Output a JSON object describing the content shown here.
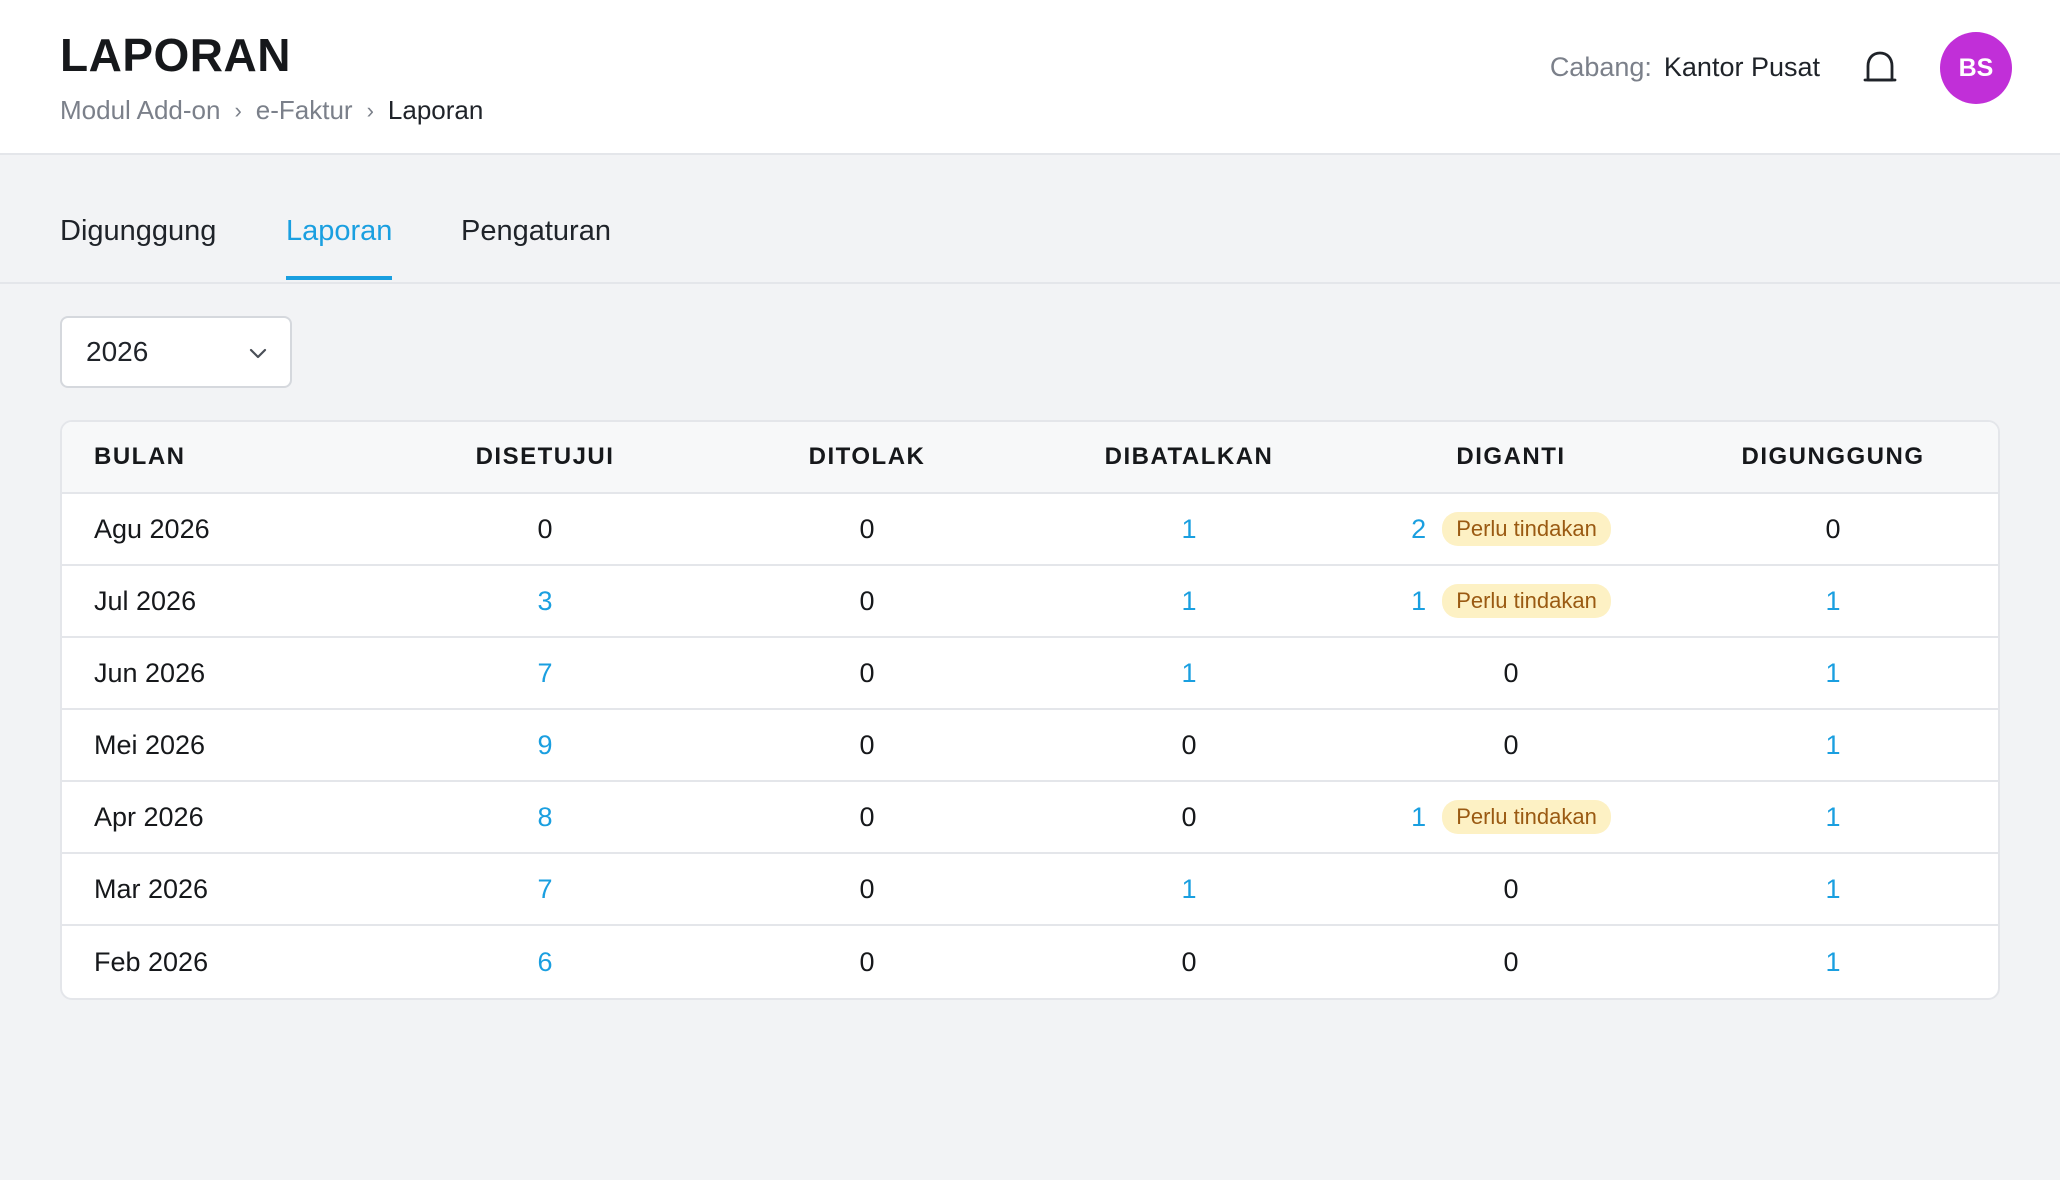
{
  "header": {
    "title": "LAPORAN",
    "breadcrumb": [
      "Modul Add-on",
      "e-Faktur",
      "Laporan"
    ],
    "branch_label": "Cabang:",
    "branch_value": "Kantor Pusat",
    "avatar_initials": "BS",
    "avatar_color": "#c12fd8"
  },
  "tabs": [
    {
      "label": "Digunggung",
      "active": false
    },
    {
      "label": "Laporan",
      "active": true
    },
    {
      "label": "Pengaturan",
      "active": false
    }
  ],
  "filter": {
    "year": "2026"
  },
  "table": {
    "columns": [
      "BULAN",
      "DISETUJUI",
      "DITOLAK",
      "DIBATALKAN",
      "DIGANTI",
      "DIGUNGGUNG"
    ],
    "badge_label": "Perlu tindakan",
    "rows": [
      {
        "bulan": "Agu 2026",
        "disetujui": "0",
        "ditolak": "0",
        "dibatalkan": "1",
        "diganti": "2",
        "diganti_badge": true,
        "digunggung": "0"
      },
      {
        "bulan": "Jul 2026",
        "disetujui": "3",
        "ditolak": "0",
        "dibatalkan": "1",
        "diganti": "1",
        "diganti_badge": true,
        "digunggung": "1"
      },
      {
        "bulan": "Jun 2026",
        "disetujui": "7",
        "ditolak": "0",
        "dibatalkan": "1",
        "diganti": "0",
        "diganti_badge": false,
        "digunggung": "1"
      },
      {
        "bulan": "Mei 2026",
        "disetujui": "9",
        "ditolak": "0",
        "dibatalkan": "0",
        "diganti": "0",
        "diganti_badge": false,
        "digunggung": "1"
      },
      {
        "bulan": "Apr 2026",
        "disetujui": "8",
        "ditolak": "0",
        "dibatalkan": "0",
        "diganti": "1",
        "diganti_badge": true,
        "digunggung": "1"
      },
      {
        "bulan": "Mar 2026",
        "disetujui": "7",
        "ditolak": "0",
        "dibatalkan": "1",
        "diganti": "0",
        "diganti_badge": false,
        "digunggung": "1"
      },
      {
        "bulan": "Feb 2026",
        "disetujui": "6",
        "ditolak": "0",
        "dibatalkan": "0",
        "diganti": "0",
        "diganti_badge": false,
        "digunggung": "1"
      }
    ]
  },
  "colors": {
    "accent": "#1a9fe0",
    "badge_bg": "#fdf1c4",
    "badge_text": "#9a5a12"
  },
  "icons": {
    "notification": "bell-icon",
    "dropdown": "chevron-down-icon"
  }
}
